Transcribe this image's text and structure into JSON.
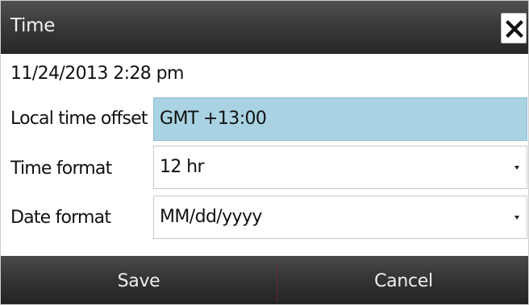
{
  "dialog": {
    "title": "Time",
    "close_icon": "close-icon"
  },
  "current_datetime": "11/24/2013 2:28 pm",
  "fields": [
    {
      "label": "Local time offset",
      "value": "GMT +13:00",
      "type": "input",
      "highlighted": true
    },
    {
      "label": "Time format",
      "value": "12 hr",
      "type": "dropdown",
      "icon": "chevron-down-icon"
    },
    {
      "label": "Date format",
      "value": "MM/dd/yyyy",
      "type": "dropdown",
      "icon": "chevron-down-icon"
    }
  ],
  "footer": {
    "save_label": "Save",
    "cancel_label": "Cancel"
  },
  "colors": {
    "titlebar": "#3a3a3a",
    "highlight": "#a9d3e3",
    "footer": "#333333",
    "divider": "#6b2a2a"
  }
}
